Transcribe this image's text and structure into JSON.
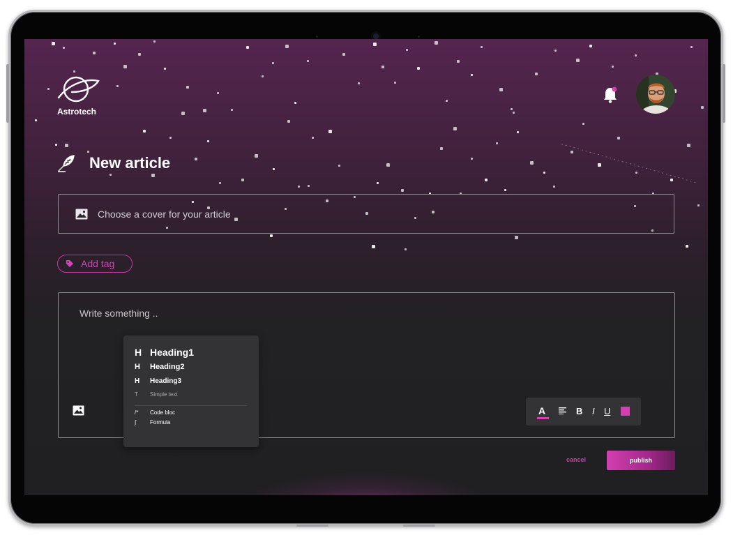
{
  "app": {
    "name": "Astrotech"
  },
  "page": {
    "title": "New article"
  },
  "cover": {
    "label": "Choose a cover for your article"
  },
  "tag": {
    "label": "Add tag"
  },
  "editor": {
    "placeholder": "Write something ..",
    "menu": {
      "items": [
        {
          "glyph": "H",
          "label": "Heading1"
        },
        {
          "glyph": "H",
          "label": "Heading2"
        },
        {
          "glyph": "H",
          "label": "Heading3"
        },
        {
          "glyph": "T",
          "label": "Simple text"
        },
        {
          "glyph": "/*",
          "label": "Code bloc"
        },
        {
          "glyph": "∫",
          "label": "Formula"
        }
      ]
    },
    "toolbar": {
      "text_color": "A",
      "bold": "B",
      "italic": "I",
      "underline": "U",
      "swatch_color": "#d63fae"
    }
  },
  "actions": {
    "cancel": "cancel",
    "publish": "publish"
  },
  "colors": {
    "accent": "#d43fb0",
    "notification_dot": "#d63fae"
  }
}
